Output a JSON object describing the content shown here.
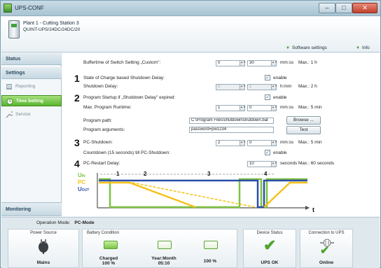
{
  "window": {
    "title": "UPS-CONF",
    "min": "–",
    "max": "□",
    "close": "✕"
  },
  "header": {
    "plant": "Plant 1 - Cutting Station 3",
    "model": "QUINT-UPS/24DC/24DC/20",
    "software_settings": "Software settings",
    "info": "Info"
  },
  "sidebar": {
    "status": "Status",
    "settings": "Settings",
    "reporting": "Reporting",
    "time_setting": "Time Setting",
    "service": "Service",
    "monitoring": "Monitoring"
  },
  "form": {
    "buffertime_label": "Buffertime of Switch Setting „Custom\":",
    "buffertime_min": "0",
    "buffertime_sec": "30",
    "buffertime_unit": "mm:ss",
    "buffertime_max": "Max.: 1 h",
    "n1": "1",
    "soc_label": "State of Charge based Shutdown Delay:",
    "soc_enable": "enable",
    "shutdown_label": "Shutdown Delay:",
    "shutdown_h": "0",
    "shutdown_m": "1",
    "shutdown_unit": "h:mm",
    "shutdown_max": "Max.: 2 h",
    "n2": "2",
    "startup_label": "Program Startup if „Shutdown Delay\" expired:",
    "startup_enable": "enable",
    "runtime_label": "Max. Program Runtime:",
    "runtime_min": "1",
    "runtime_sec": "0",
    "runtime_unit": "mm:ss",
    "runtime_max": "Max.: 5 min",
    "path_label": "Program path:",
    "path_value": "C:\\Program Files\\shutdown\\shutdown.bat",
    "browse": "Browse ...",
    "args_label": "Program arguments:",
    "args_value": "password=pw1234",
    "test": "Test",
    "n3": "3",
    "pc_shutdown_label": "PC-Shutdown:",
    "pc_min": "2",
    "pc_sec": "0",
    "pc_unit": "mm:ss",
    "pc_max": "Max.: 5 min",
    "countdown_label": "Countdown (15 seconds) till PC-Shutdown:",
    "countdown_enable": "enable",
    "n4": "4",
    "restart_label": "PC-Restart Delay:",
    "restart_val": "10",
    "restart_unit": "seconds",
    "restart_max": "Max.: 60 seconds"
  },
  "diagram": {
    "u_in": "U",
    "u_in_sub": "IN",
    "pc": "PC",
    "u_out": "U",
    "u_out_sub": "OUT",
    "t": "t",
    "m1": "1",
    "m2": "2",
    "m3": "3",
    "m4": "4",
    "green": "#7dc242",
    "yellow": "#f5c218",
    "blue": "#2b4ea8"
  },
  "status": {
    "op_mode_label": "Operation Mode:",
    "op_mode_value": "PC-Mode",
    "power_source_title": "Power Source",
    "power_source_value": "Mains",
    "battery_title": "Battery Condition",
    "battery_state": "Charged",
    "battery_pct": "100 %",
    "yearmonth_label": "Year:Month",
    "yearmonth_value": "05:10",
    "battery_pct2": "100 %",
    "device_title": "Device Status",
    "device_value": "UPS OK",
    "conn_title": "Connection to UPS",
    "conn_value": "Online"
  }
}
